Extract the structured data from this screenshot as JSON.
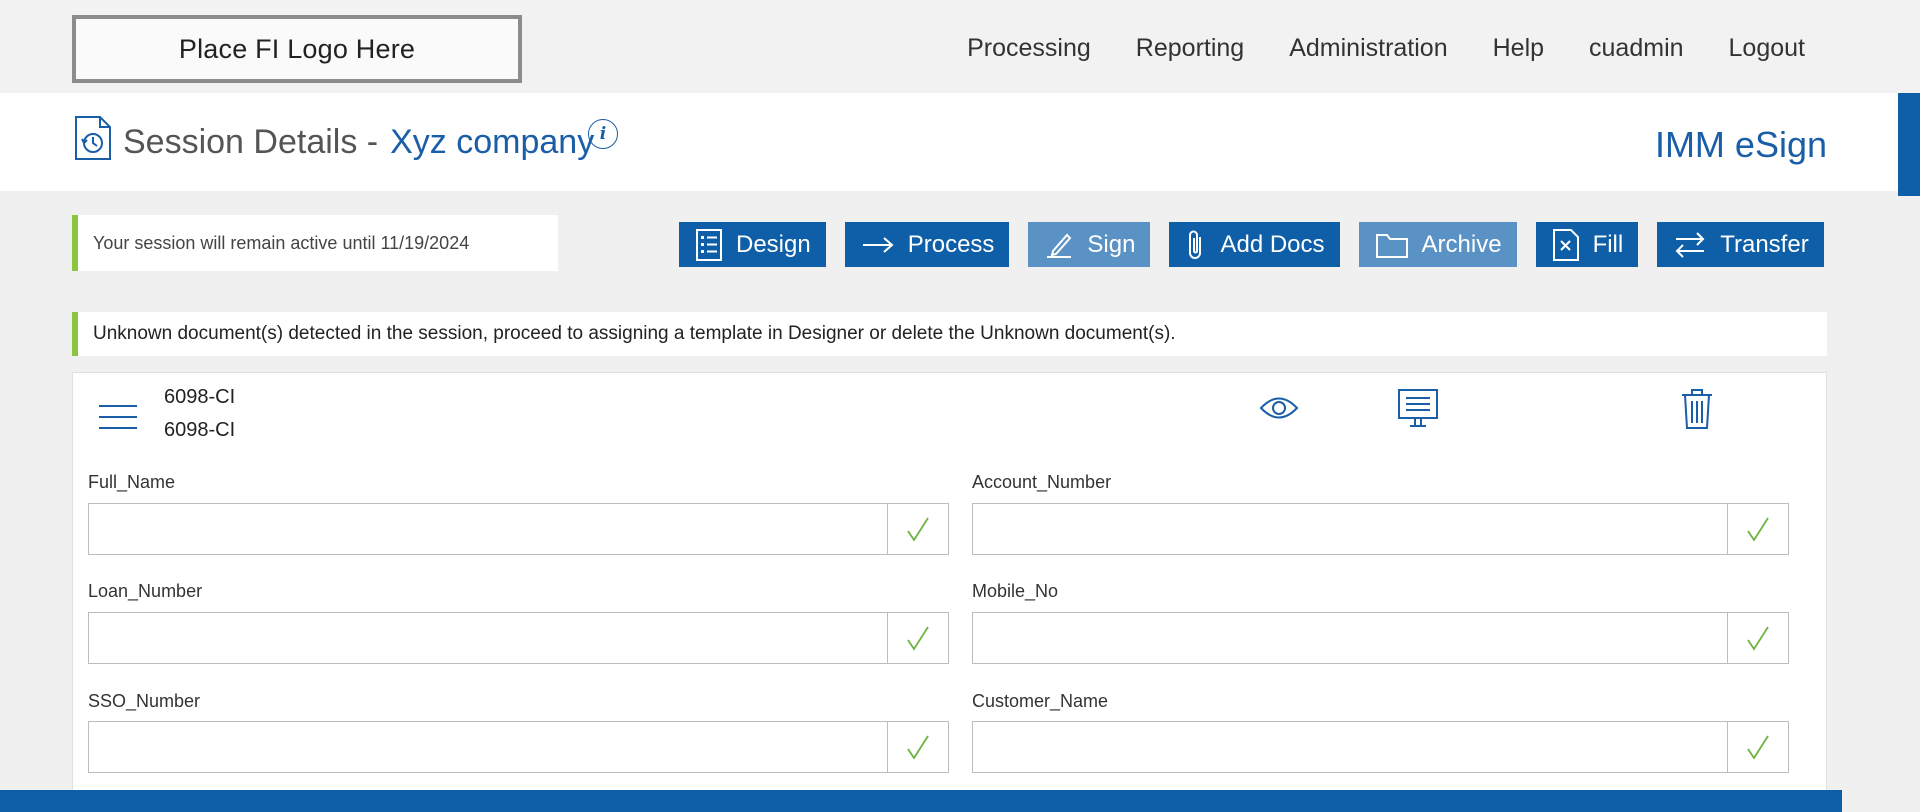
{
  "header": {
    "logo_text": "Place FI Logo Here",
    "nav": [
      "Processing",
      "Reporting",
      "Administration",
      "Help",
      "cuadmin",
      "Logout"
    ]
  },
  "title_band": {
    "title_prefix": "Session Details -",
    "company": "Xyz company",
    "info_icon_text": "i",
    "brand": "IMM eSign"
  },
  "session_note": "Your session will remain active until 11/19/2024",
  "actions": [
    {
      "label": "Design",
      "icon": "form-list-icon",
      "state": "active"
    },
    {
      "label": "Process",
      "icon": "arrow-right-icon",
      "state": "active"
    },
    {
      "label": "Sign",
      "icon": "pen-icon",
      "state": "disabled"
    },
    {
      "label": "Add Docs",
      "icon": "paperclip-icon",
      "state": "active"
    },
    {
      "label": "Archive",
      "icon": "folder-icon",
      "state": "disabled"
    },
    {
      "label": "Fill",
      "icon": "document-fill-icon",
      "state": "active"
    },
    {
      "label": "Transfer",
      "icon": "transfer-arrows-icon",
      "state": "active"
    }
  ],
  "alert": "Unknown document(s) detected in the session, proceed to assigning a template in Designer or delete the Unknown document(s).",
  "document": {
    "name_line1": "6098-CI",
    "name_line2": "6098-CI",
    "fields": [
      {
        "label": "Full_Name",
        "value": ""
      },
      {
        "label": "Account_Number",
        "value": ""
      },
      {
        "label": "Loan_Number",
        "value": ""
      },
      {
        "label": "Mobile_No",
        "value": ""
      },
      {
        "label": "SSO_Number",
        "value": ""
      },
      {
        "label": "Customer_Name",
        "value": ""
      }
    ]
  },
  "colors": {
    "primary": "#0f5fa8",
    "primary_disabled": "#5b92c5",
    "accent_green": "#8cc63f",
    "check_green": "#6db33f"
  }
}
